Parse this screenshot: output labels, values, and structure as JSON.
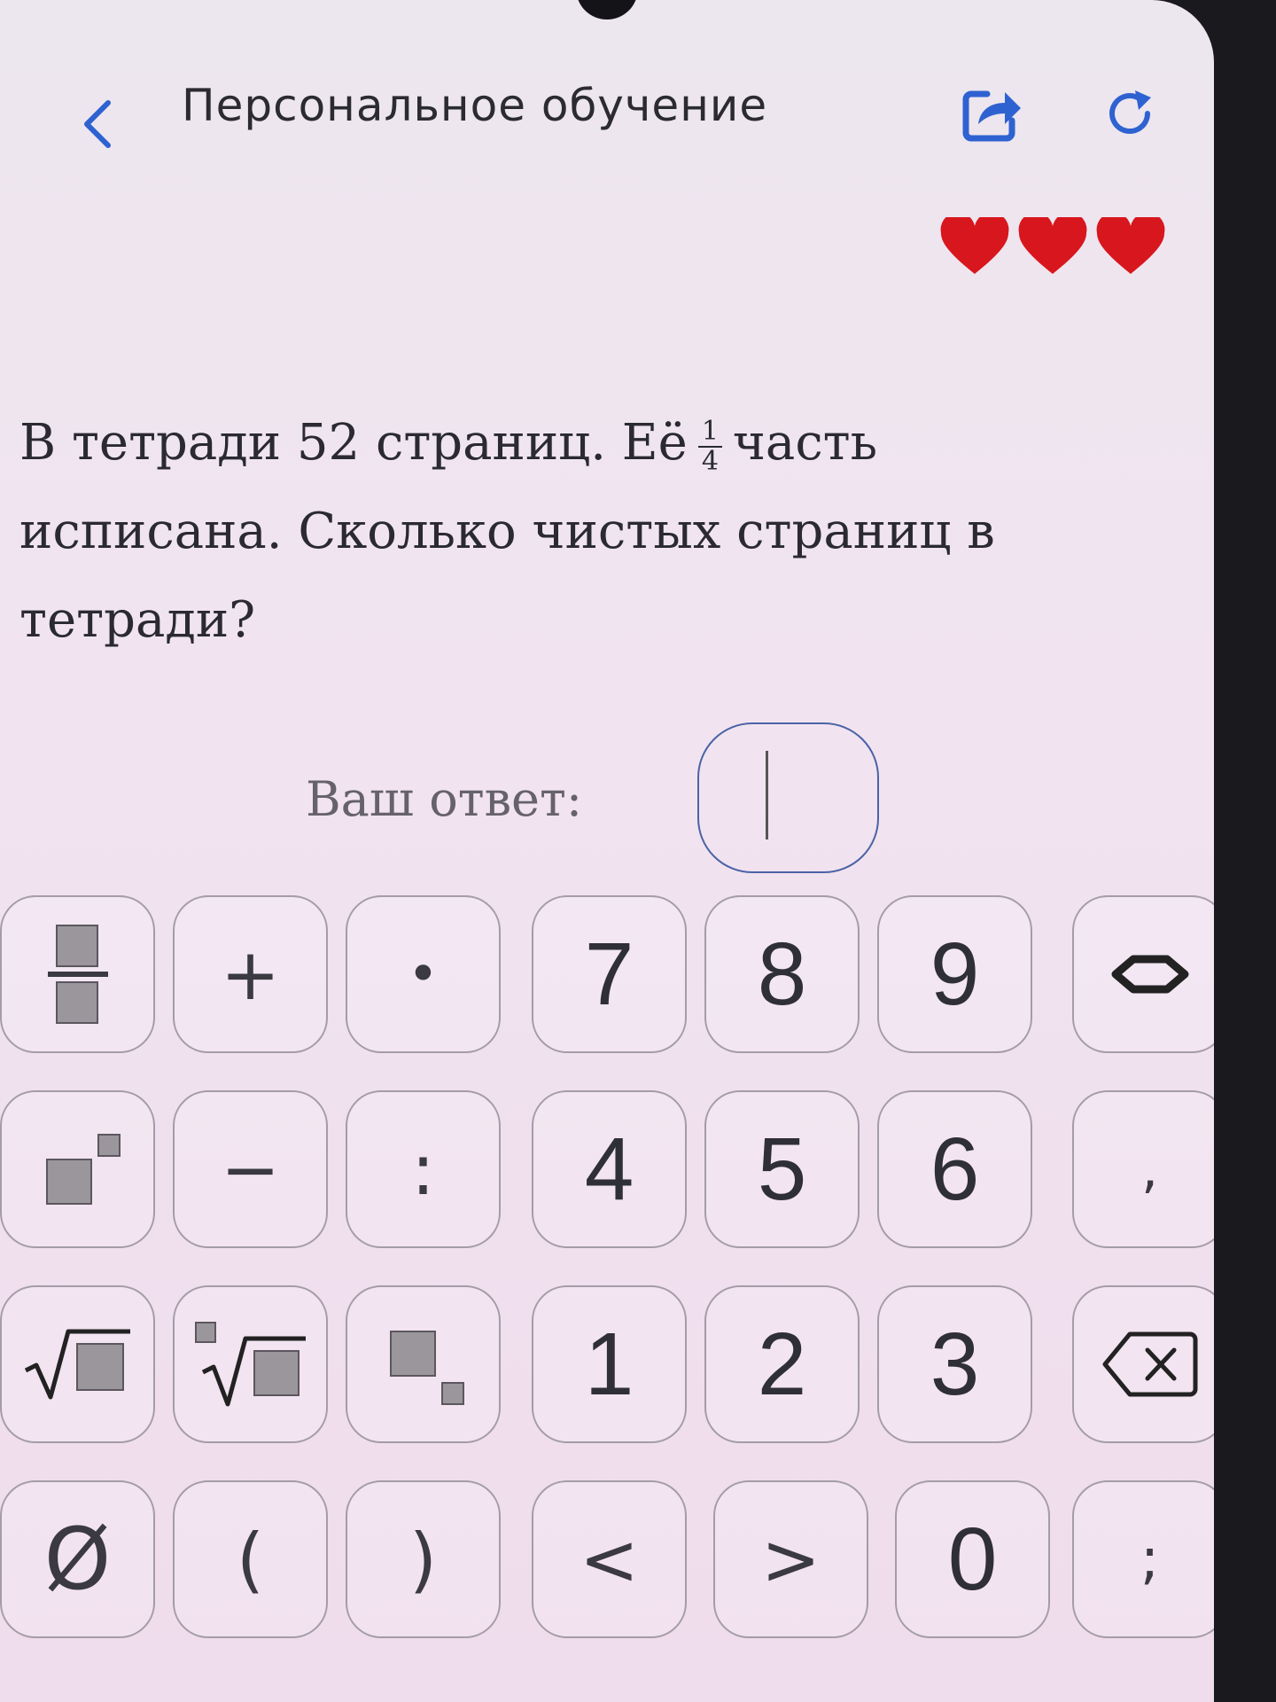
{
  "header": {
    "title": "Персональное обучение",
    "back_icon": "chevron-left-icon",
    "share_icon": "share-icon",
    "refresh_icon": "refresh-icon"
  },
  "hearts": {
    "count": 3,
    "icon": "heart-icon",
    "color": "#d8161d"
  },
  "question": {
    "line1_before": "В тетради 52 страниц. Её",
    "fraction_numerator": "1",
    "fraction_denominator": "4",
    "line1_after": "часть",
    "line2": "исписана. Сколько чистых страниц в",
    "line3": "тетради?"
  },
  "answer": {
    "label": "Ваш ответ:",
    "value": ""
  },
  "keypad": {
    "row1": [
      "fraction",
      "+",
      "•",
      "7",
      "8",
      "9",
      "◇"
    ],
    "row2": [
      "power",
      "−",
      ":",
      "4",
      "5",
      "6",
      ","
    ],
    "row3": [
      "sqrt",
      "nth-root",
      "subscript",
      "1",
      "2",
      "3",
      "backspace"
    ],
    "row4": [
      "Ø",
      "(",
      ")",
      "<",
      ">",
      "0",
      ";"
    ]
  },
  "colors": {
    "accent": "#2e62d1",
    "text": "#2a2a30",
    "key_border": "#a49ca8"
  }
}
